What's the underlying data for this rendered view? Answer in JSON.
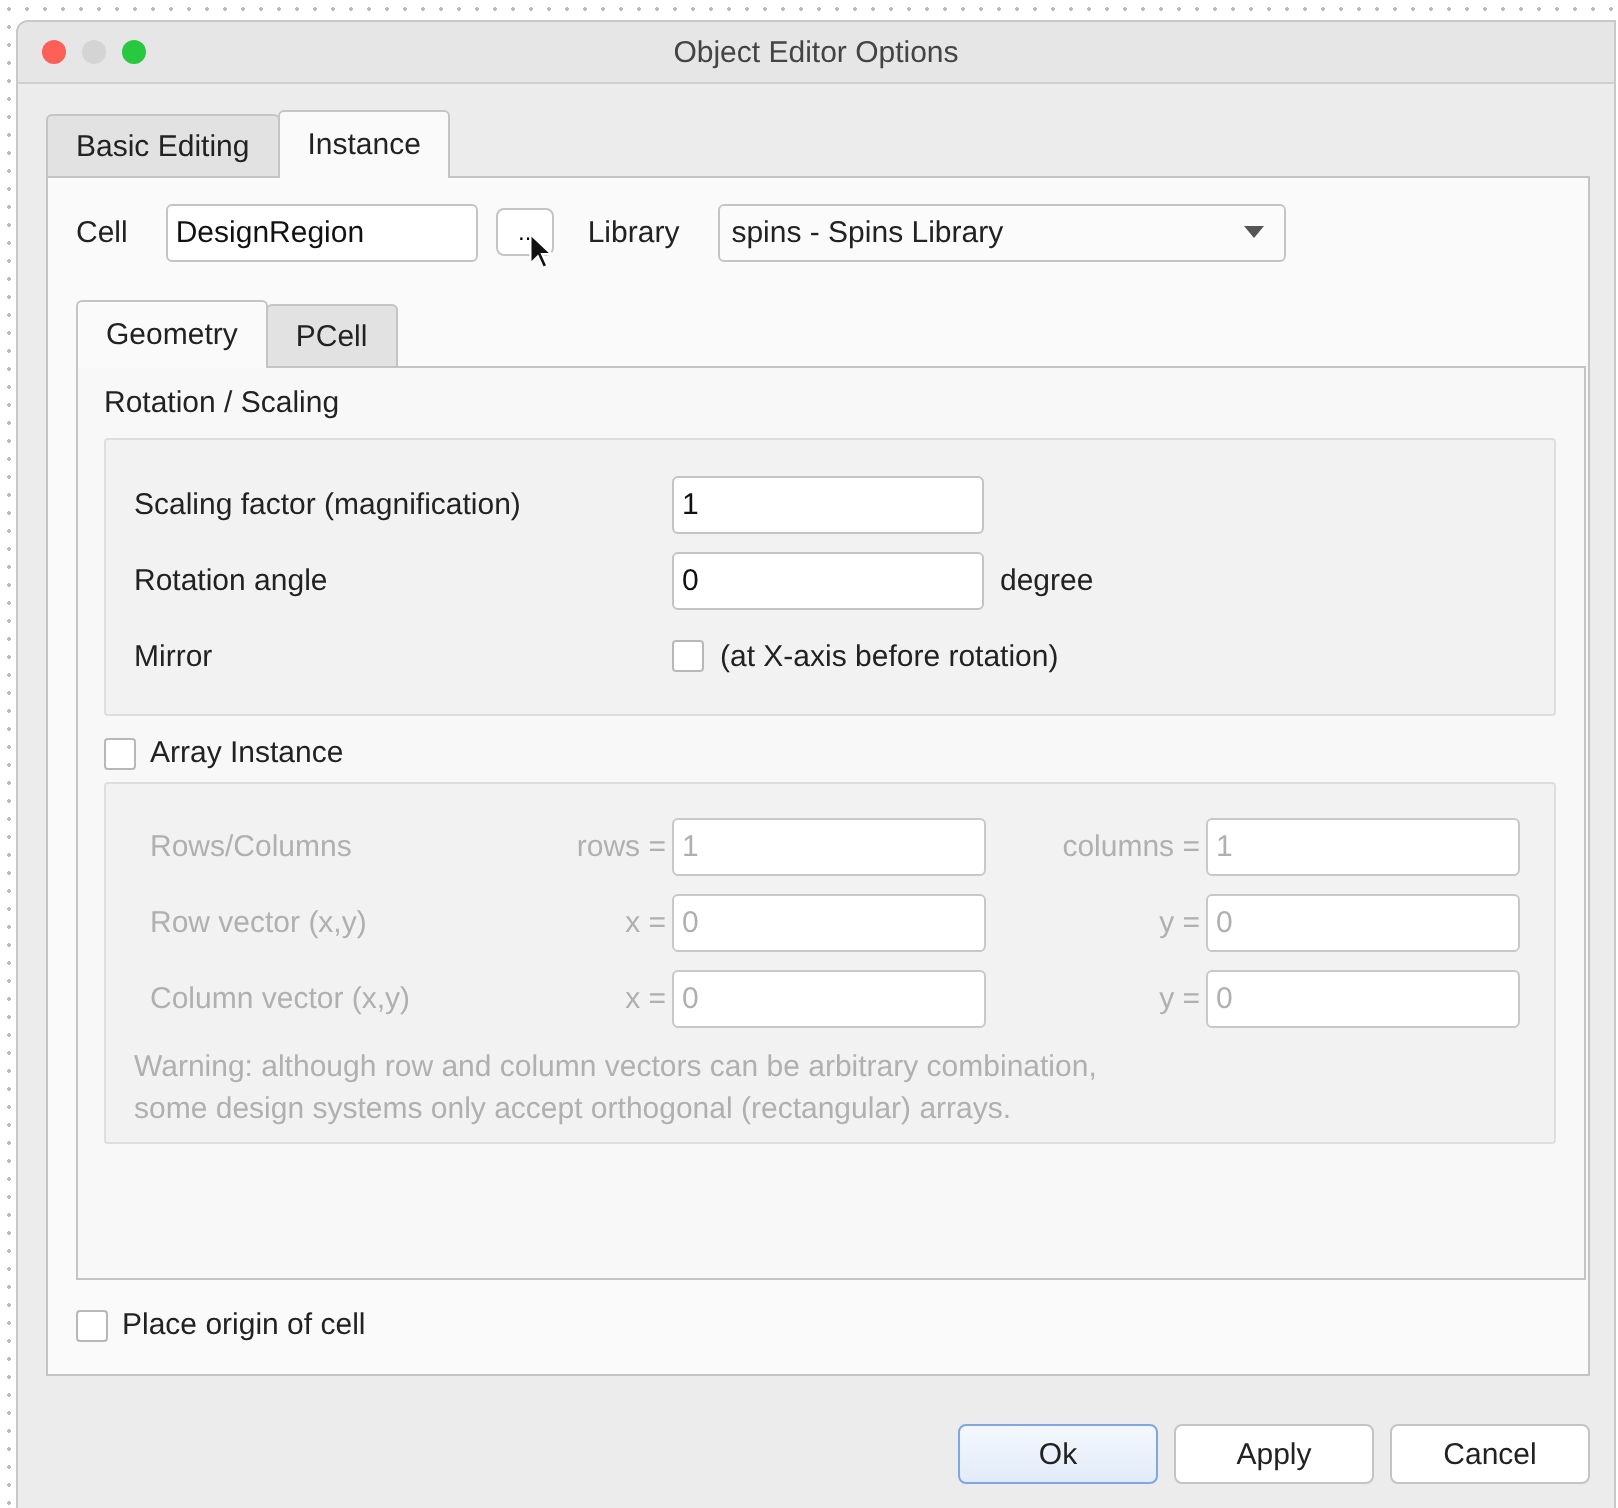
{
  "window": {
    "title": "Object Editor Options"
  },
  "tabs": [
    {
      "label": "Basic Editing",
      "selected": false
    },
    {
      "label": "Instance",
      "selected": true
    }
  ],
  "cell": {
    "label": "Cell",
    "value": "DesignRegion",
    "browse_button": ".."
  },
  "library": {
    "label": "Library",
    "value": "spins - Spins Library"
  },
  "subtabs": [
    {
      "label": "Geometry",
      "selected": true
    },
    {
      "label": "PCell",
      "selected": false
    }
  ],
  "rotation_scaling": {
    "title": "Rotation / Scaling",
    "scaling": {
      "label": "Scaling factor (magnification)",
      "value": "1"
    },
    "rotation": {
      "label": "Rotation angle",
      "value": "0",
      "unit": "degree"
    },
    "mirror": {
      "label": "Mirror",
      "checked": false,
      "text": "(at X-axis before rotation)"
    }
  },
  "array_instance": {
    "label": "Array Instance",
    "checked": false,
    "rows": [
      {
        "label": "Rows/Columns",
        "first_label": "rows =",
        "first_value": "1",
        "second_label": "columns =",
        "second_value": "1"
      },
      {
        "label": "Row vector (x,y)",
        "first_label": "x =",
        "first_value": "0",
        "second_label": "y =",
        "second_value": "0"
      },
      {
        "label": "Column vector (x,y)",
        "first_label": "x =",
        "first_value": "0",
        "second_label": "y =",
        "second_value": "0"
      }
    ],
    "warning": "Warning: although row and column vectors can be arbitrary combination,\nsome design systems only accept orthogonal (rectangular) arrays."
  },
  "place_origin": {
    "label": "Place origin of cell",
    "checked": false
  },
  "buttons": [
    {
      "label": "Ok",
      "default": true
    },
    {
      "label": "Apply",
      "default": false
    },
    {
      "label": "Cancel",
      "default": false
    }
  ]
}
